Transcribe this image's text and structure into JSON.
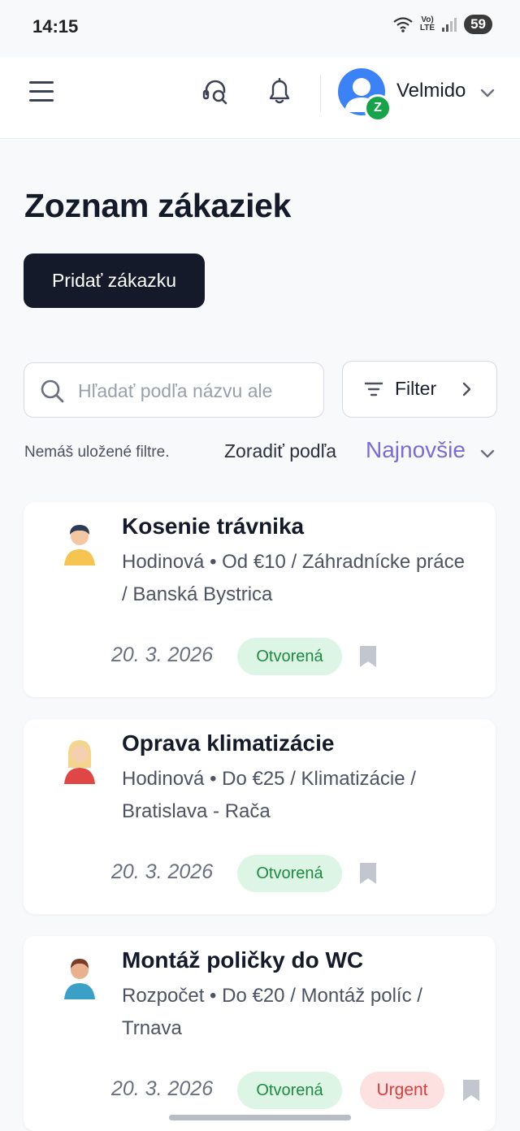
{
  "status_bar": {
    "time": "14:15",
    "network": "LTE",
    "battery": "59"
  },
  "app_bar": {
    "user_name": "Velmido",
    "avatar_badge": "Z"
  },
  "page": {
    "title": "Zoznam zákaziek",
    "add_button": "Pridať zákazku"
  },
  "search": {
    "placeholder": "Hľadať podľa názvu ale"
  },
  "filter": {
    "label": "Filter"
  },
  "filters_info": {
    "no_saved": "Nemáš uložené filtre."
  },
  "sort": {
    "label": "Zoradiť podľa",
    "value": "Najnovšie"
  },
  "jobs": [
    {
      "title": "Kosenie trávnika",
      "subtitle": "Hodinová • Od €10 / Záhradnícke práce / Banská Bystrica",
      "date": "20. 3. 2026",
      "status": "Otvorená",
      "urgent": ""
    },
    {
      "title": "Oprava klimatizácie",
      "subtitle": "Hodinová • Do €25 / Klimatizácie / Bratislava - Rača",
      "date": "20. 3. 2026",
      "status": "Otvorená",
      "urgent": ""
    },
    {
      "title": "Montáž poličky do WC",
      "subtitle": "Rozpočet • Do €20 / Montáž políc / Trnava",
      "date": "20. 3. 2026",
      "status": "Otvorená",
      "urgent": "Urgent"
    }
  ],
  "colors": {
    "accent": "#7c6bd6",
    "primary_button": "#141a2a",
    "status_open_bg": "#dcf5e4",
    "status_open_text": "#1f8a43",
    "urgent_bg": "#fde0e0",
    "urgent_text": "#d2403f"
  }
}
